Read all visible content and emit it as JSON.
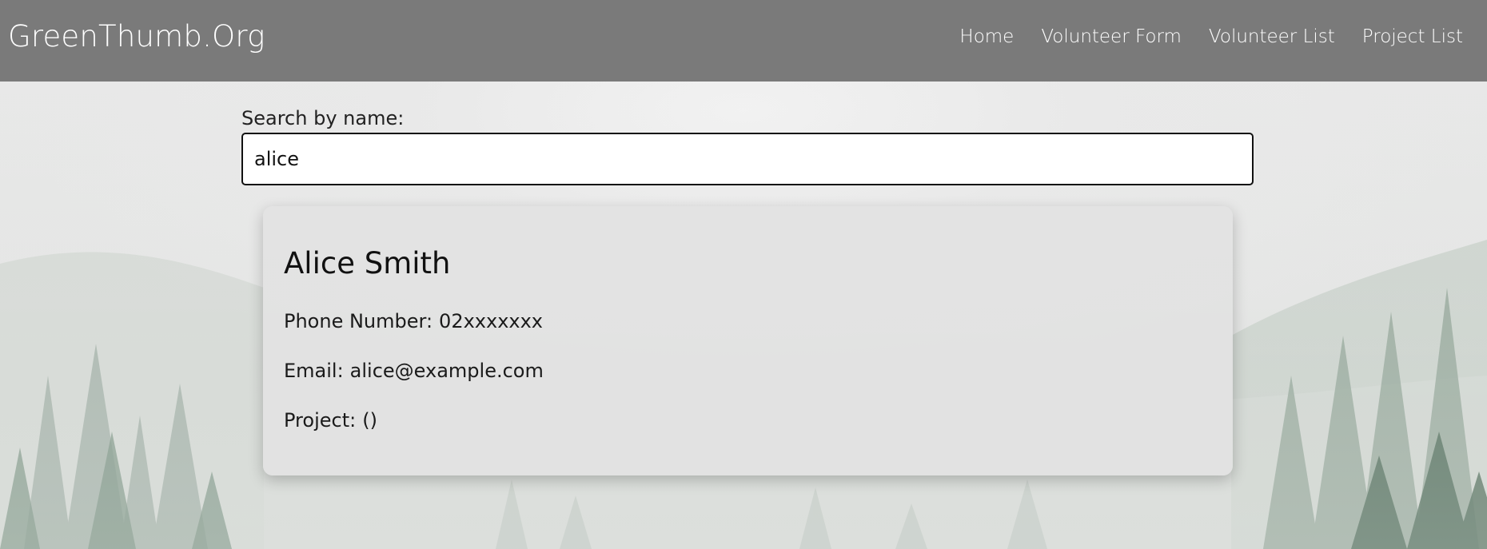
{
  "navbar": {
    "brand": "GreenThumb.Org",
    "links": [
      "Home",
      "Volunteer Form",
      "Volunteer List",
      "Project List"
    ]
  },
  "search": {
    "label": "Search by name:",
    "value": "alice"
  },
  "result": {
    "name": "Alice Smith",
    "phone_label": "Phone Number:",
    "phone_value": "02xxxxxxx",
    "email_label": "Email:",
    "email_value": "alice@example.com",
    "project_label": "Project:",
    "project_value": "()"
  },
  "colors": {
    "navbar": "#7a7a7a",
    "nav_text": "#ffffff",
    "card": "#e2e2e2"
  }
}
